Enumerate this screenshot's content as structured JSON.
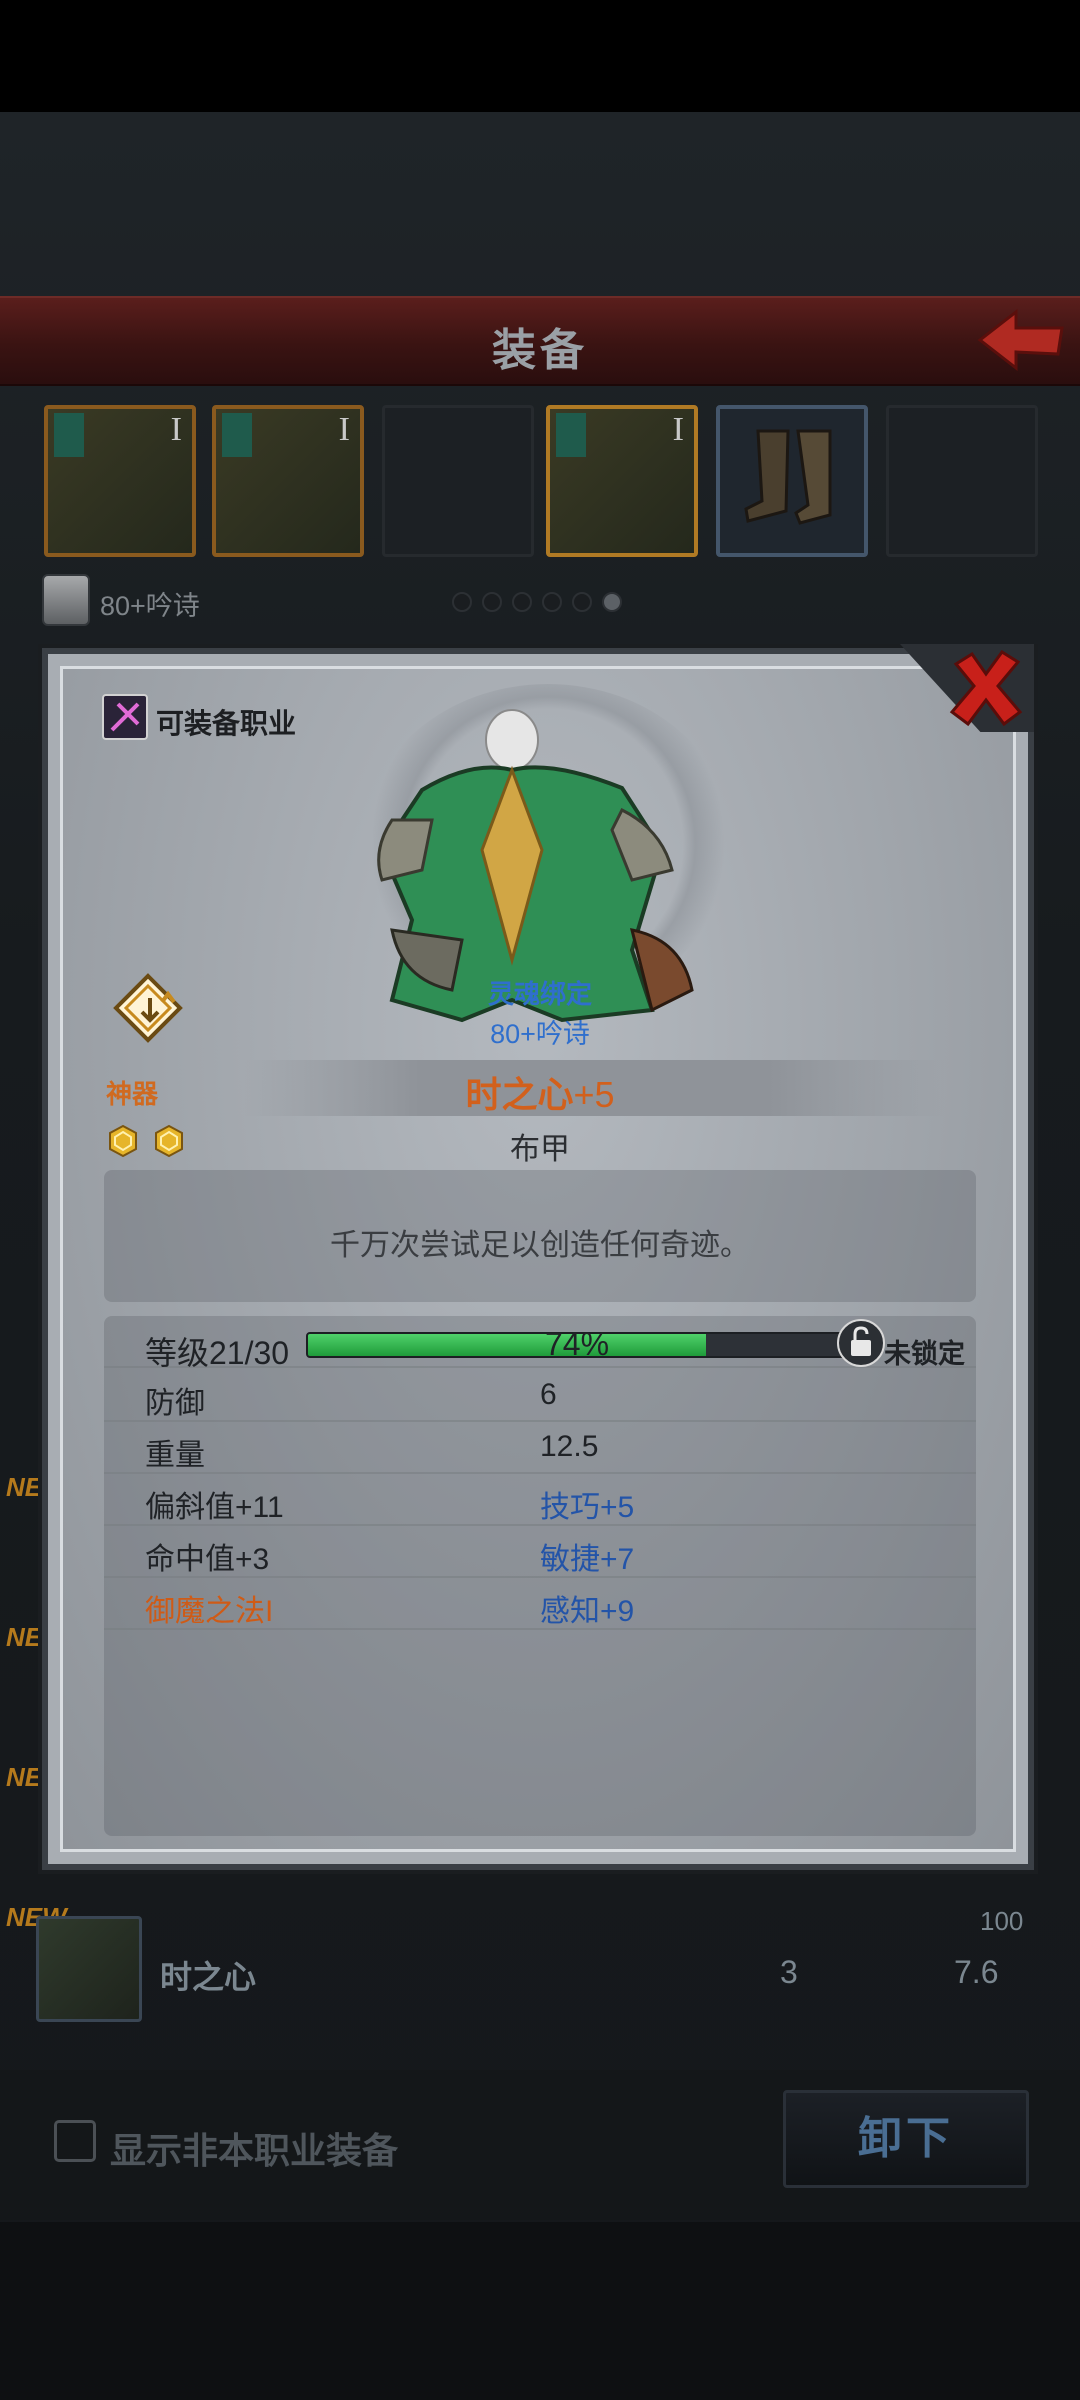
{
  "header": {
    "title": "装备"
  },
  "character": {
    "label": "80+吟诗",
    "page_dots": 6,
    "active_dot": 5
  },
  "slots": [
    {
      "tier": "I",
      "state": "filled"
    },
    {
      "tier": "I",
      "state": "filled"
    },
    {
      "tier": "",
      "state": "empty"
    },
    {
      "tier": "I",
      "state": "filled"
    },
    {
      "tier": "",
      "state": "blue"
    },
    {
      "tier": "",
      "state": "empty"
    }
  ],
  "background_list": {
    "new_tag": "NEW",
    "item_name": "时之心",
    "value_top": "100",
    "value_1": "3",
    "value_2": "7.6"
  },
  "footer": {
    "checkbox_label": "显示非本职业装备",
    "unequip_label": "卸下"
  },
  "modal": {
    "class_label": "可装备职业",
    "soulbound": "灵魂绑定",
    "owner": "80+吟诗",
    "rarity": "神器",
    "name": "时之心",
    "enhance": "+5",
    "type": "布甲",
    "description": "千万次尝试足以创造任何奇迹。",
    "level_label": "等级21/30",
    "xp_percent": 74,
    "xp_text": "74%",
    "lock_label": "未锁定",
    "stats": [
      {
        "left": "防御",
        "right": "6",
        "left_color": "dark",
        "right_color": "dark"
      },
      {
        "left": "重量",
        "right": "12.5",
        "left_color": "dark",
        "right_color": "dark"
      },
      {
        "left": "偏斜值+11",
        "right": "技巧+5",
        "left_color": "dark",
        "right_color": "blue"
      },
      {
        "left": "命中值+3",
        "right": "敏捷+7",
        "left_color": "dark",
        "right_color": "blue"
      },
      {
        "left": "御魔之法I",
        "right": "感知+9",
        "left_color": "orange",
        "right_color": "blue"
      }
    ]
  },
  "colors": {
    "rarity": "#d2601c",
    "stat_blue": "#2354a8",
    "xp_green": "#2fb24a"
  }
}
